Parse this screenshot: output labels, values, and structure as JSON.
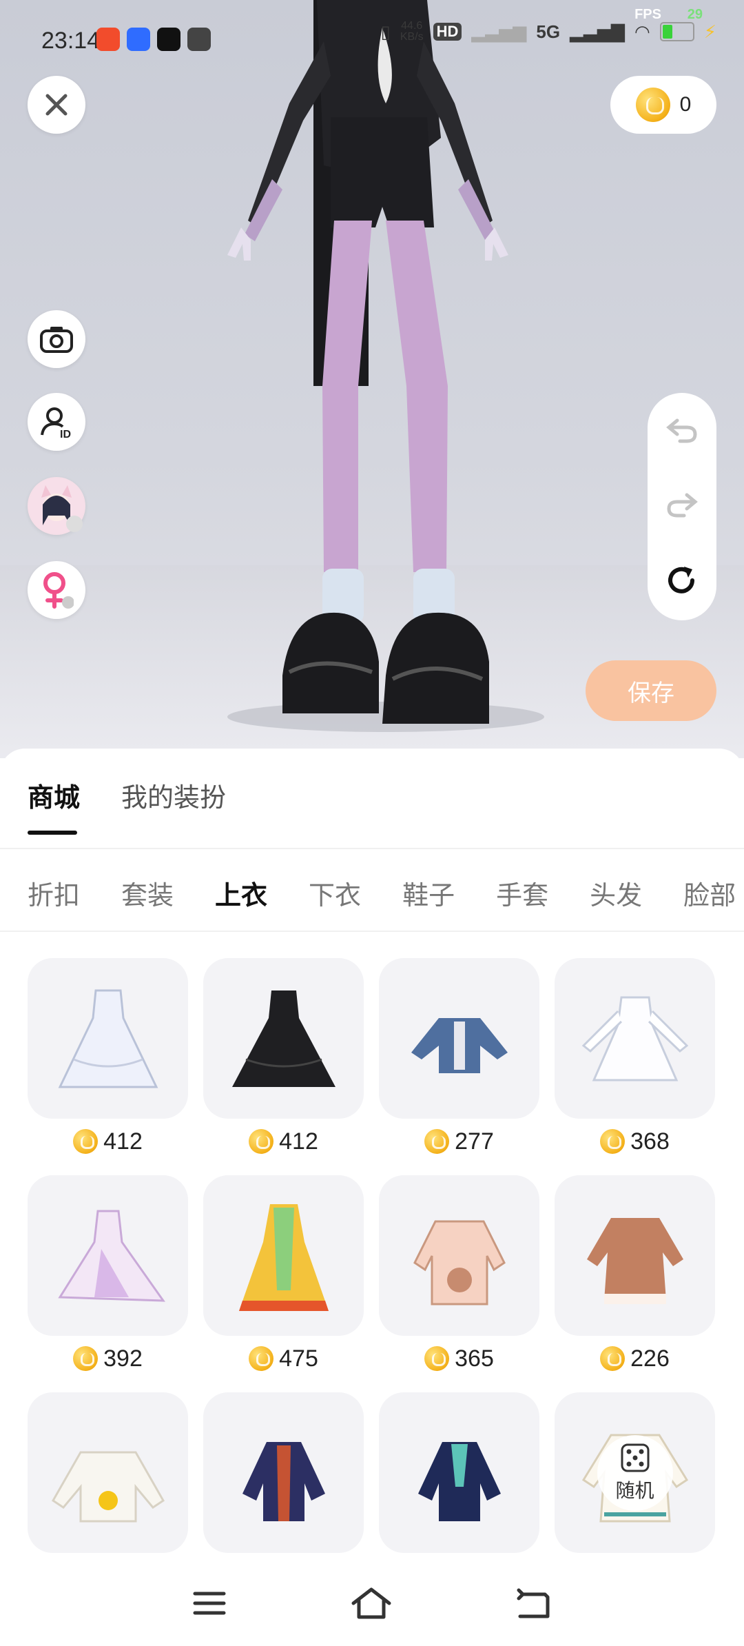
{
  "status_bar": {
    "time": "23:14",
    "network_speed": "44.6",
    "network_unit": "KB/s",
    "hd_label": "HD",
    "signal_label": "5G",
    "fps_label": "FPS",
    "fps_value": "29"
  },
  "wallet": {
    "coin_balance": "0"
  },
  "actions": {
    "save_label": "保存"
  },
  "tabs": [
    {
      "label": "商城",
      "active": true
    },
    {
      "label": "我的装扮",
      "active": false
    }
  ],
  "categories": [
    {
      "label": "折扣",
      "active": false
    },
    {
      "label": "套装",
      "active": false
    },
    {
      "label": "上衣",
      "active": true
    },
    {
      "label": "下衣",
      "active": false
    },
    {
      "label": "鞋子",
      "active": false
    },
    {
      "label": "手套",
      "active": false
    },
    {
      "label": "头发",
      "active": false
    },
    {
      "label": "脸部",
      "active": false
    }
  ],
  "items": [
    {
      "price": "412"
    },
    {
      "price": "412"
    },
    {
      "price": "277"
    },
    {
      "price": "368"
    },
    {
      "price": "392"
    },
    {
      "price": "475"
    },
    {
      "price": "365"
    },
    {
      "price": "226"
    },
    {
      "price": ""
    },
    {
      "price": ""
    },
    {
      "price": ""
    },
    {
      "price": ""
    }
  ],
  "random_label": "随机",
  "colors": {
    "accent_save": "#f9c3a0",
    "coin_gold": "#f4b11a",
    "female_pink": "#f0508a"
  },
  "icons": [
    "close-icon",
    "coin-icon",
    "camera-icon",
    "user-id-icon",
    "avatar-switch",
    "female-icon",
    "undo-icon",
    "redo-icon",
    "reset-icon",
    "dice-icon",
    "menu-icon",
    "home-icon",
    "back-icon"
  ]
}
